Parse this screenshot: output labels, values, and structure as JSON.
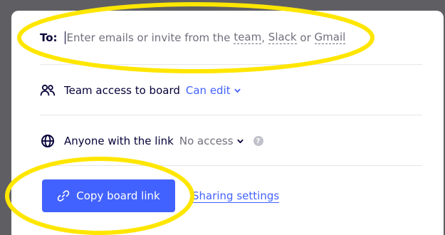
{
  "share": {
    "to_label": "To:",
    "invite_prefix": "Enter emails or invite from the",
    "invite_team": "team",
    "invite_comma": ",",
    "invite_slack": "Slack",
    "invite_or": "or",
    "invite_gmail": "Gmail",
    "team_access_label": "Team access to board",
    "team_access_value": "Can edit",
    "anyone_label": "Anyone with the link",
    "anyone_value": "No access",
    "help_glyph": "?",
    "copy_button_label": "Copy board link",
    "sharing_settings_label": "Sharing settings"
  },
  "icons": {
    "team": "team-icon",
    "globe": "globe-icon",
    "link": "link-icon",
    "chevron": "chevron-down-icon",
    "help": "help-icon"
  },
  "colors": {
    "accent": "#4262ff",
    "text_dark": "#050038",
    "text_muted": "#706f7d",
    "annotation": "#ffe600",
    "backdrop": "#5f5f63"
  }
}
